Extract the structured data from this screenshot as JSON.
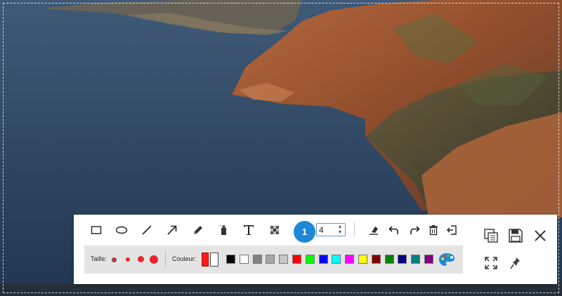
{
  "toolbar": {
    "tools": [
      {
        "name": "rectangle-tool",
        "icon": "rectangle-icon"
      },
      {
        "name": "ellipse-tool",
        "icon": "ellipse-icon"
      },
      {
        "name": "line-tool",
        "icon": "line-icon"
      },
      {
        "name": "arrow-tool",
        "icon": "arrow-icon"
      },
      {
        "name": "pencil-tool",
        "icon": "pencil-icon"
      },
      {
        "name": "marker-tool",
        "icon": "marker-icon"
      },
      {
        "name": "text-tool",
        "icon": "text-icon"
      },
      {
        "name": "pixelate-tool",
        "icon": "pixelate-icon"
      }
    ],
    "counter_label": "1",
    "size_value": "4",
    "actions": [
      {
        "name": "eraser-button",
        "icon": "eraser-icon"
      },
      {
        "name": "undo-button",
        "icon": "undo-icon"
      },
      {
        "name": "redo-button",
        "icon": "redo-icon"
      },
      {
        "name": "delete-button",
        "icon": "trash-icon"
      },
      {
        "name": "exit-button",
        "icon": "exit-icon"
      }
    ],
    "side_actions": [
      {
        "name": "copy-button",
        "icon": "copy-icon"
      },
      {
        "name": "save-button",
        "icon": "floppy-disk-icon"
      },
      {
        "name": "close-button",
        "icon": "close-icon"
      },
      {
        "name": "fullscreen-button",
        "icon": "expand-icon"
      },
      {
        "name": "pin-button",
        "icon": "pin-icon"
      }
    ]
  },
  "options": {
    "size_label": "Taille:",
    "color_label": "Couleur:",
    "current_foreground": "#ff1a1a",
    "current_background": "#ffffff",
    "palette": [
      "#000000",
      "#ffffff",
      "#808080",
      "#a8a8a8",
      "#c8c8c8",
      "#ff0000",
      "#00ff00",
      "#0000ff",
      "#00ffff",
      "#ff00ff",
      "#ffff00",
      "#800000",
      "#008000",
      "#000080",
      "#008080",
      "#800080"
    ]
  },
  "colors": {
    "accent": "#1e88d6",
    "options_bar": "#e4e4e4"
  }
}
